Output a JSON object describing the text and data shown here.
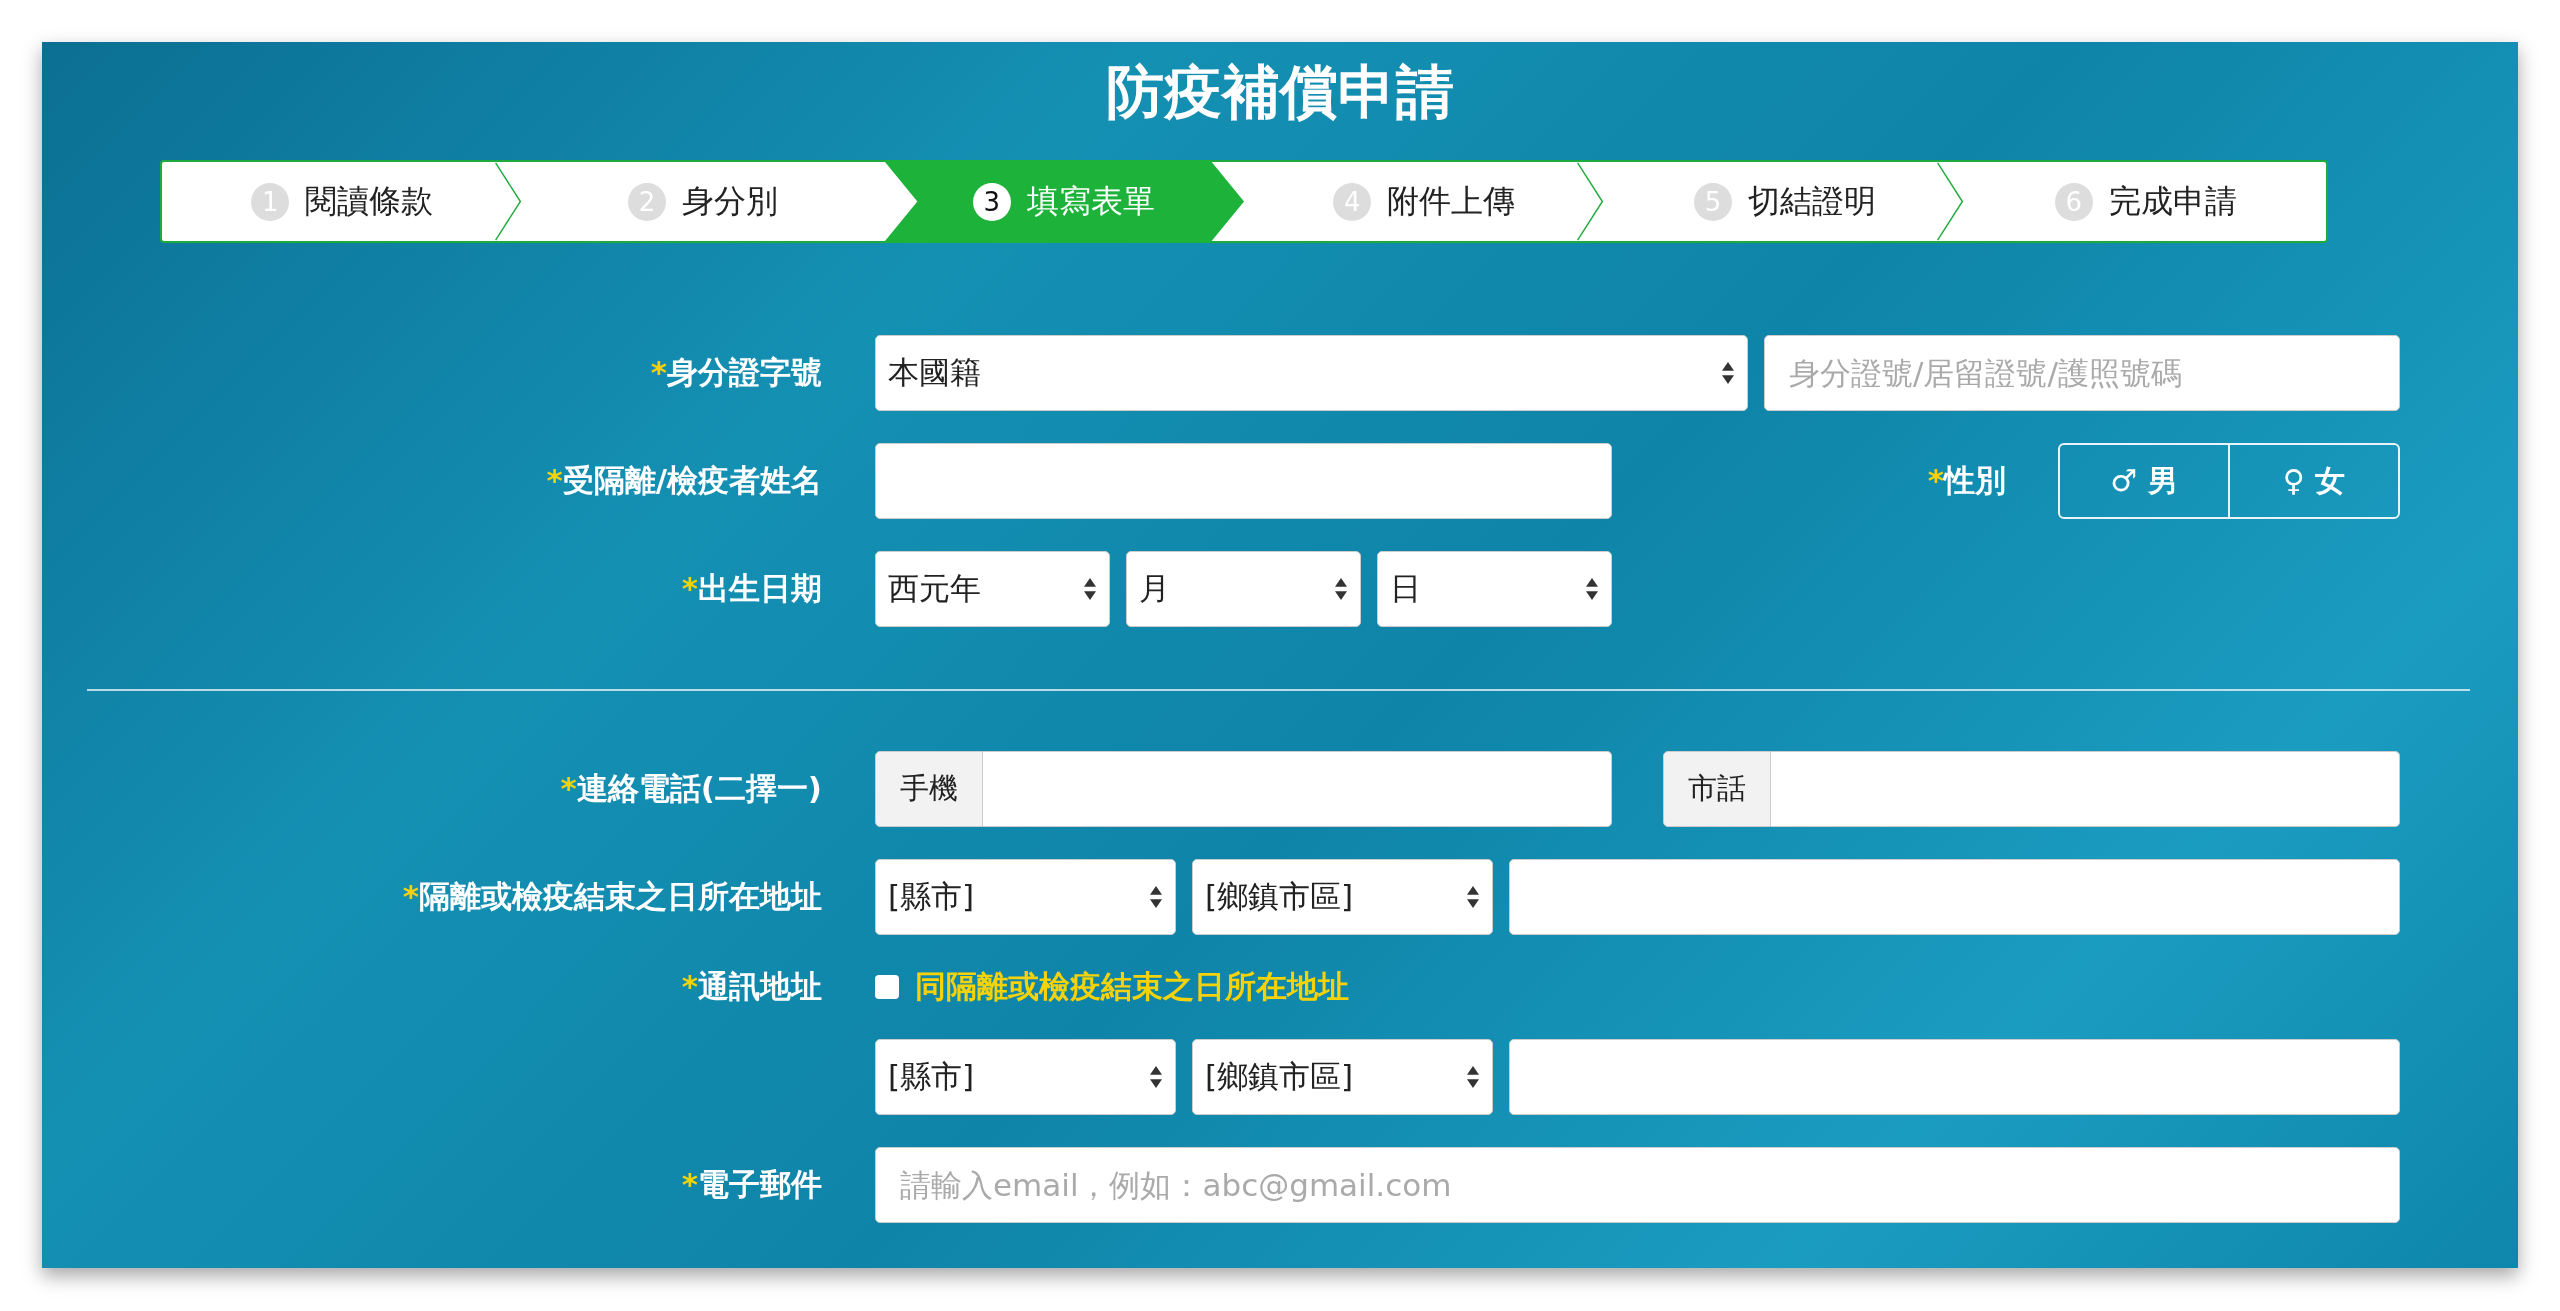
{
  "title": "防疫補償申請",
  "steps": [
    {
      "number": "1",
      "label": "閱讀條款",
      "selected": false
    },
    {
      "number": "2",
      "label": "身分別",
      "selected": false
    },
    {
      "number": "3",
      "label": "填寫表單",
      "selected": true
    },
    {
      "number": "4",
      "label": "附件上傳",
      "selected": false
    },
    {
      "number": "5",
      "label": "切結證明",
      "selected": false
    },
    {
      "number": "6",
      "label": "完成申請",
      "selected": false
    }
  ],
  "rows": [
    {
      "kind": "field",
      "marker": "*",
      "label": "身分證字號",
      "controls": [
        {
          "kind": "select",
          "value": "本國籍"
        },
        {
          "kind": "input",
          "placeholder": "身分證號/居留證號/護照號碼"
        }
      ]
    },
    {
      "kind": "field",
      "marker": "*",
      "label": "受隔離/檢疫者姓名",
      "controls": [
        {
          "kind": "input"
        },
        {
          "kind": "gender",
          "marker": "*",
          "label": "性別",
          "options": [
            {
              "symbol": "♂",
              "label": "男",
              "selected": false
            },
            {
              "symbol": "♀",
              "label": "女",
              "selected": false
            }
          ]
        }
      ]
    },
    {
      "kind": "field",
      "marker": "*",
      "label": "出生日期",
      "controls": [
        {
          "kind": "select",
          "value": "西元年"
        },
        {
          "kind": "select",
          "value": "月"
        },
        {
          "kind": "select",
          "value": "日"
        }
      ]
    },
    {
      "kind": "divider"
    },
    {
      "kind": "field",
      "marker": "*",
      "label": "連絡電話(二擇一)",
      "controls": [
        {
          "kind": "addon",
          "addon": "手機"
        },
        {
          "kind": "addon",
          "addon": "市話"
        }
      ]
    },
    {
      "kind": "field",
      "marker": "*",
      "label": "隔離或檢疫結束之日所在地址",
      "controls": [
        {
          "kind": "select",
          "value": "[縣市]"
        },
        {
          "kind": "select",
          "value": "[鄉鎮市區]"
        },
        {
          "kind": "input"
        }
      ]
    },
    {
      "kind": "field",
      "marker": "*",
      "label": "通訊地址",
      "controls": [
        {
          "kind": "checkbox",
          "checked": false,
          "label": "同隔離或檢疫結束之日所在地址"
        }
      ]
    },
    {
      "kind": "field",
      "controls": [
        {
          "kind": "select",
          "value": "[縣市]"
        },
        {
          "kind": "select",
          "value": "[鄉鎮市區]"
        },
        {
          "kind": "input"
        }
      ]
    },
    {
      "kind": "field",
      "marker": "*",
      "label": "電子郵件",
      "controls": [
        {
          "kind": "input",
          "placeholder": "請輸入email，例如：abc@gmail.com"
        }
      ]
    }
  ]
}
